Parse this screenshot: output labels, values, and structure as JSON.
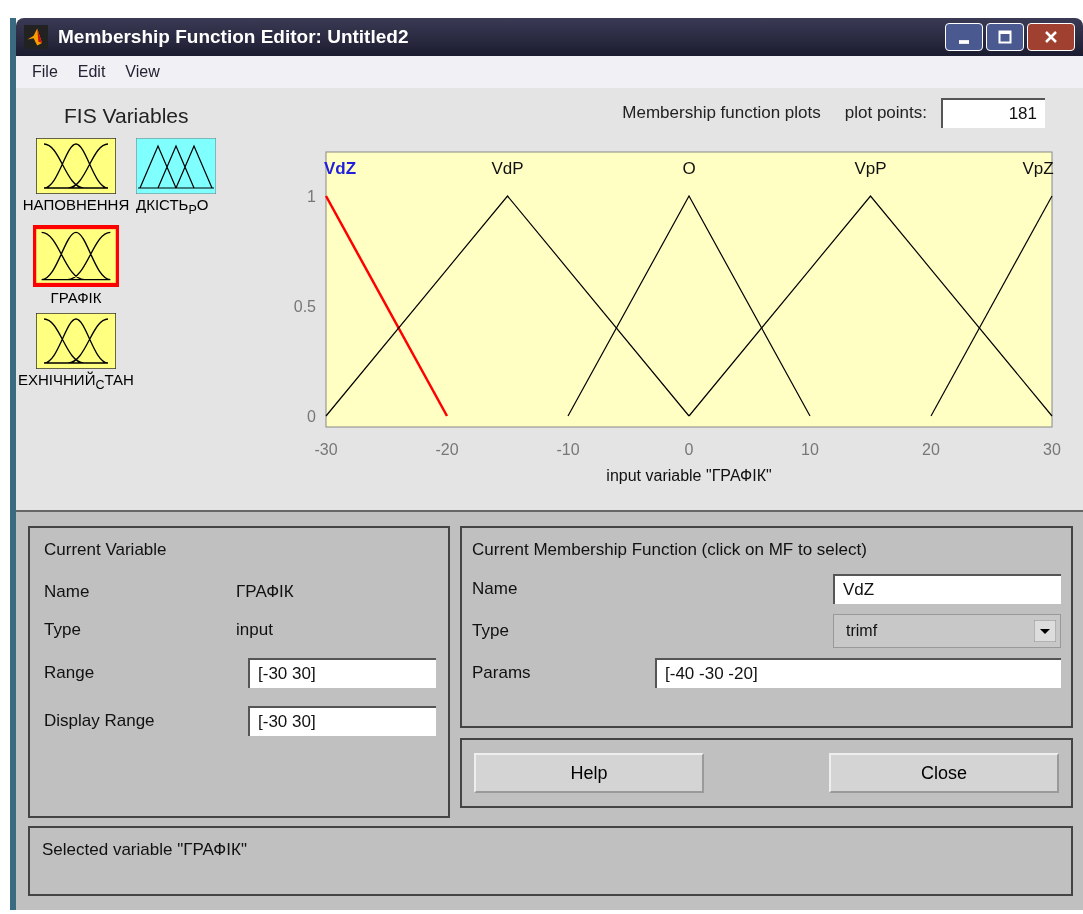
{
  "window": {
    "title": "Membership Function Editor: Untitled2"
  },
  "menu": [
    "File",
    "Edit",
    "View"
  ],
  "fis_variables": {
    "title": "FIS Variables",
    "items": [
      {
        "label": "НАПОВНЕННЯ",
        "kind": "input",
        "selected": false
      },
      {
        "label": "ДКІСТЬ$_{Р}$О",
        "kind": "output",
        "selected": false
      },
      {
        "label": "ГРАФІК",
        "kind": "input",
        "selected": true
      },
      {
        "label": "ЕХНІЧНИЙ$_{С}$ТАН",
        "kind": "input",
        "selected": false
      }
    ]
  },
  "plot": {
    "title": "Membership function plots",
    "plot_points_label": "plot points:",
    "plot_points": "181",
    "mfs": [
      {
        "selected": true
      },
      {
        "selected": false
      },
      {
        "selected": false
      },
      {
        "selected": false
      },
      {
        "selected": false
      }
    ],
    "chart_data": {
      "type": "line",
      "xlabel": "input variable \"ГРАФІК\"",
      "x": [
        -30,
        -20,
        -15,
        -10,
        0,
        10,
        15,
        20,
        30
      ],
      "xlim": [
        -30,
        30
      ],
      "ylim": [
        -0.05,
        1.2
      ],
      "xticks": [
        -30,
        -20,
        -10,
        0,
        10,
        20,
        30
      ],
      "yticks": [
        0,
        0.5,
        1
      ],
      "series": [
        {
          "name": "VdZ",
          "color": "#ff0000",
          "values": [
            1,
            0,
            null,
            null,
            null,
            null,
            null,
            null,
            null
          ]
        },
        {
          "name": "VdP",
          "color": "#000000",
          "values": [
            0,
            0.667,
            1,
            0.667,
            0,
            null,
            null,
            null,
            null
          ]
        },
        {
          "name": "O",
          "color": "#000000",
          "values": [
            null,
            null,
            null,
            0,
            1,
            0,
            null,
            null,
            null
          ]
        },
        {
          "name": "VpP",
          "color": "#000000",
          "values": [
            null,
            null,
            null,
            null,
            0,
            0.667,
            1,
            0.667,
            0
          ]
        },
        {
          "name": "VpZ",
          "color": "#000000",
          "values": [
            null,
            null,
            null,
            null,
            null,
            null,
            null,
            0,
            1
          ]
        }
      ]
    }
  },
  "current_variable": {
    "title": "Current Variable",
    "name_label": "Name",
    "name": "ГРАФІК",
    "type_label": "Type",
    "type": "input",
    "range_label": "Range",
    "range": "[-30 30]",
    "display_range_label": "Display Range",
    "display_range": "[-30 30]"
  },
  "current_mf": {
    "title": "Current Membership Function (click on MF to select)",
    "name_label": "Name",
    "name": "VdZ",
    "type_label": "Type",
    "type": "trimf",
    "params_label": "Params",
    "params": "[-40 -30 -20]"
  },
  "buttons": [
    "Help",
    "Close"
  ],
  "status": "Selected variable \"ГРАФІК\""
}
